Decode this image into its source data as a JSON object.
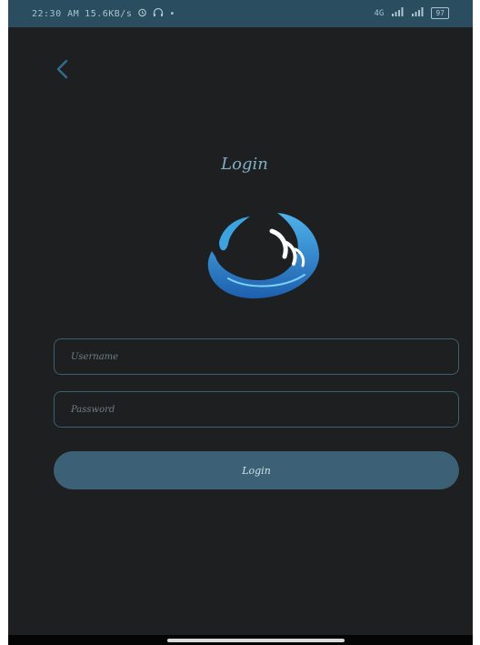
{
  "status_bar": {
    "time": "22:30 AM",
    "speed": "15.6KB/s",
    "network": "4G",
    "battery": "97"
  },
  "page": {
    "title": "Login"
  },
  "form": {
    "username_placeholder": "Username",
    "password_placeholder": "Password",
    "login_button": "Login"
  },
  "colors": {
    "background": "#1e1f21",
    "status_bar": "#2a4e5f",
    "accent": "#3c6176",
    "title": "#7fb0c6"
  },
  "icons": {
    "back": "chevron-left-icon",
    "logo": "water-wave-logo",
    "alarm": "alarm-icon",
    "headphones": "headphones-icon",
    "signal": "signal-icon"
  }
}
